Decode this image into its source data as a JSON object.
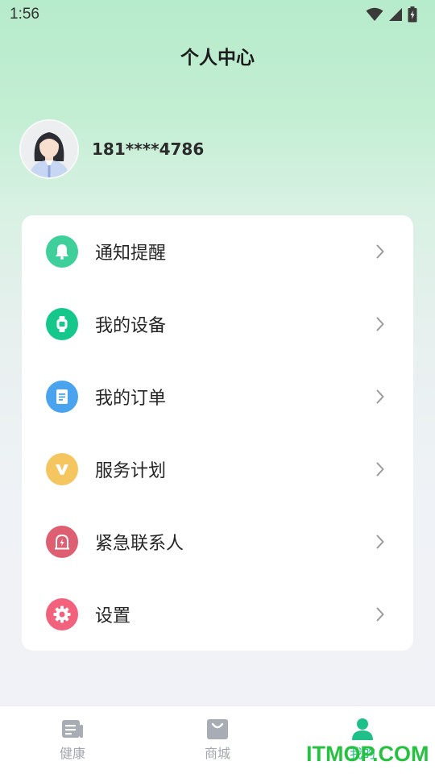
{
  "status_bar": {
    "time": "1:56"
  },
  "header": {
    "title": "个人中心"
  },
  "profile": {
    "phone": "181****4786"
  },
  "menu": {
    "items": [
      {
        "label": "通知提醒",
        "icon": "bell-icon",
        "color": "#3ecf9a"
      },
      {
        "label": "我的设备",
        "icon": "watch-icon",
        "color": "#16c78b"
      },
      {
        "label": "我的订单",
        "icon": "document-icon",
        "color": "#4aa3ee"
      },
      {
        "label": "服务计划",
        "icon": "v-badge-icon",
        "color": "#f5c560"
      },
      {
        "label": "紧急联系人",
        "icon": "alarm-icon",
        "color": "#de5e72"
      },
      {
        "label": "设置",
        "icon": "gear-icon",
        "color": "#f2627c"
      }
    ]
  },
  "bottom_nav": {
    "items": [
      {
        "label": "健康",
        "icon": "news-icon",
        "active": false
      },
      {
        "label": "商城",
        "icon": "shopping-bag-icon",
        "active": false
      },
      {
        "label": "我的",
        "icon": "person-icon",
        "active": true
      }
    ],
    "active_color": "#1fbf8a"
  },
  "watermark": {
    "text": "ITMOP.COM"
  }
}
